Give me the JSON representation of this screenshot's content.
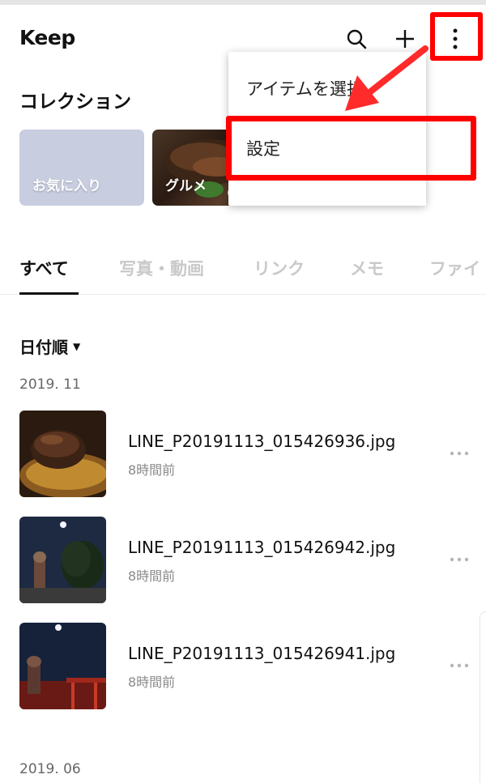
{
  "header": {
    "title": "Keep",
    "icons": [
      "search-icon",
      "plus-icon",
      "more-vertical-icon"
    ]
  },
  "collections": {
    "title": "コレクション",
    "items": [
      {
        "label": "お気に入り"
      },
      {
        "label": "グルメ"
      },
      {
        "label": ""
      }
    ]
  },
  "tabs": [
    "すべて",
    "写真・動画",
    "リンク",
    "メモ",
    "ファイ"
  ],
  "active_tab": "すべて",
  "sort": {
    "label": "日付順"
  },
  "groups": [
    {
      "date": "2019. 11",
      "items": [
        {
          "name": "LINE_P20191113_015426936.jpg",
          "time": "8時間前"
        },
        {
          "name": "LINE_P20191113_015426942.jpg",
          "time": "8時間前"
        },
        {
          "name": "LINE_P20191113_015426941.jpg",
          "time": "8時間前"
        }
      ]
    },
    {
      "date": "2019. 06",
      "items": []
    }
  ],
  "menu": {
    "items": [
      {
        "label": "アイテムを選択"
      },
      {
        "label": "設定"
      }
    ]
  },
  "colors": {
    "highlight": "#ff0000",
    "active_text": "#111111",
    "inactive_tab": "#c9c9c9",
    "favorites_card": "#c8cde0"
  }
}
